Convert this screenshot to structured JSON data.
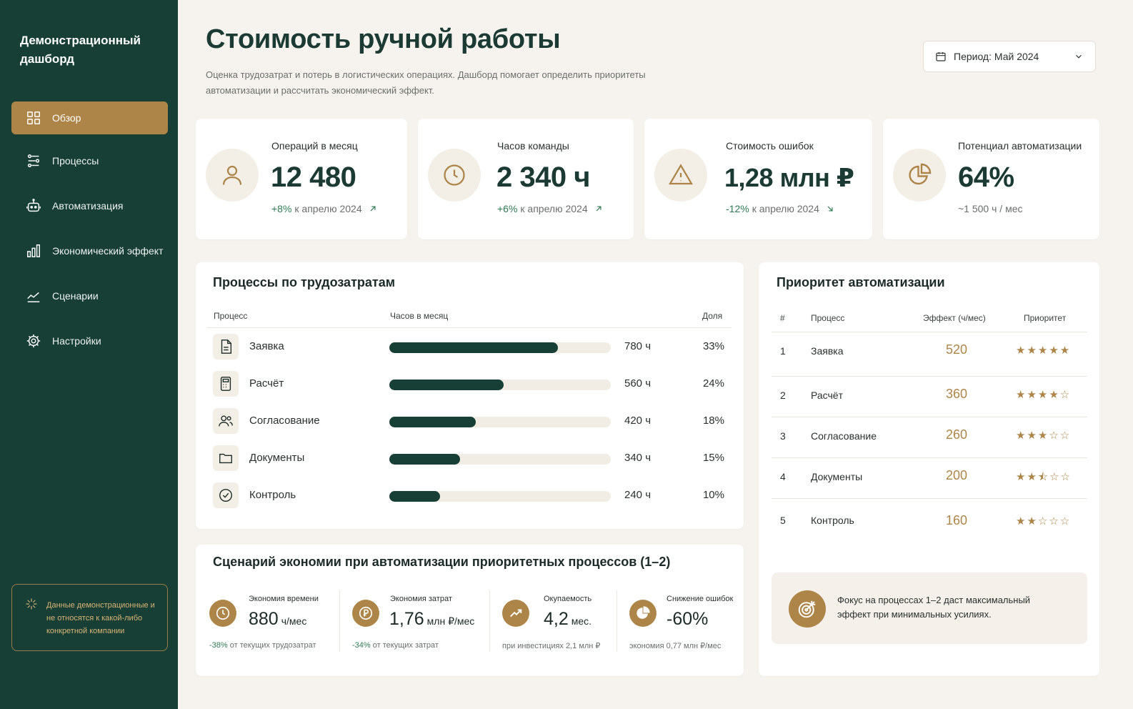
{
  "brand": "Демонстрационный дашборд",
  "nav": [
    {
      "label": "Обзор",
      "icon": "grid-icon",
      "active": true
    },
    {
      "label": "Процессы",
      "icon": "process-icon"
    },
    {
      "label": "Автоматизация",
      "icon": "robot-icon"
    },
    {
      "label": "Экономический эффект",
      "icon": "bar-chart-icon"
    },
    {
      "label": "Сценарии",
      "icon": "trend-icon"
    },
    {
      "label": "Настройки",
      "icon": "gear-icon"
    }
  ],
  "note": "Данные демонстрационные и не относятся к какой-либо конкретной компании",
  "header": {
    "title": "Стоимость ручной работы",
    "subtitle": "Оценка трудозатрат и потерь в логистических операциях. Дашборд помогает определить приоритеты автоматизации и рассчитать экономический эффект.",
    "period": "Период: Май 2024"
  },
  "kpis": [
    {
      "label": "Операций в месяц",
      "value": "12 480",
      "delta": "+8%",
      "sub": "к апрелю 2024",
      "icon": "user-icon"
    },
    {
      "label": "Часов команды",
      "value": "2 340 ч",
      "delta": "+6%",
      "sub": "к апрелю 2024",
      "icon": "clock-icon"
    },
    {
      "label": "Стоимость ошибок",
      "value": "1,28 млн ₽",
      "delta": "-12%",
      "sub": "к апрелю 2024",
      "icon": "warning-icon"
    },
    {
      "label": "Потенциал автоматизации",
      "value": "64%",
      "delta": "",
      "sub": "~1 500 ч / мес",
      "icon": "pie-icon"
    }
  ],
  "processes": {
    "title": "Процессы по трудозатратам",
    "headers": [
      "Процесс",
      "Часов в месяц",
      "Доля"
    ],
    "rows": [
      {
        "name": "Заявка",
        "hours": "780 ч",
        "share": "33%",
        "fill": 0.76,
        "icon": "document-icon"
      },
      {
        "name": "Расчёт",
        "hours": "560 ч",
        "share": "24%",
        "fill": 0.515,
        "icon": "calculator-icon"
      },
      {
        "name": "Согласование",
        "hours": "420 ч",
        "share": "18%",
        "fill": 0.39,
        "icon": "users-icon"
      },
      {
        "name": "Документы",
        "hours": "340 ч",
        "share": "15%",
        "fill": 0.32,
        "icon": "folder-icon"
      },
      {
        "name": "Контроль",
        "hours": "240 ч",
        "share": "10%",
        "fill": 0.23,
        "icon": "check-circle-icon"
      }
    ]
  },
  "priority": {
    "title": "Приоритет автоматизации",
    "headers": [
      "#",
      "Процесс",
      "Эффект (ч/мес)",
      "Приоритет"
    ],
    "rows": [
      {
        "num": "1",
        "name": "Заявка",
        "effect": "520",
        "stars": "★★★★★"
      },
      {
        "num": "2",
        "name": "Расчёт",
        "effect": "360",
        "stars": "★★★★☆"
      },
      {
        "num": "3",
        "name": "Согласование",
        "effect": "260",
        "stars": "★★★☆☆"
      },
      {
        "num": "4",
        "name": "Документы",
        "effect": "200",
        "stars": "★★⯪☆☆"
      },
      {
        "num": "5",
        "name": "Контроль",
        "effect": "160",
        "stars": "★★☆☆☆"
      }
    ],
    "focus": "Фокус на процессах 1–2 даст максимальный эффект при минимальных усилиях."
  },
  "scenario": {
    "title": "Сценарий экономии при автоматизации приоритетных процессов (1–2)",
    "items": [
      {
        "label": "Экономия времени",
        "value": "880",
        "unit": "ч/мес",
        "delta": "-38%",
        "note": "от текущих трудозатрат",
        "icon": "clock-icon"
      },
      {
        "label": "Экономия затрат",
        "value": "1,76",
        "unit": "млн ₽/мес",
        "delta": "-34%",
        "note": "от текущих затрат",
        "icon": "coin-icon"
      },
      {
        "label": "Окупаемость",
        "value": "4,2",
        "unit": "мес.",
        "delta": "",
        "note": "при инвестициях 2,1 млн ₽",
        "icon": "trend-up-icon"
      },
      {
        "label": "Снижение ошибок",
        "value": "-60%",
        "unit": "",
        "delta": "",
        "note": "экономия 0,77 млн ₽/мес",
        "icon": "pie-icon"
      }
    ]
  },
  "colors": {
    "sidebar": "#173f36",
    "accent": "#ad8548",
    "positive": "#2f7a55",
    "bar": "#173f36"
  }
}
